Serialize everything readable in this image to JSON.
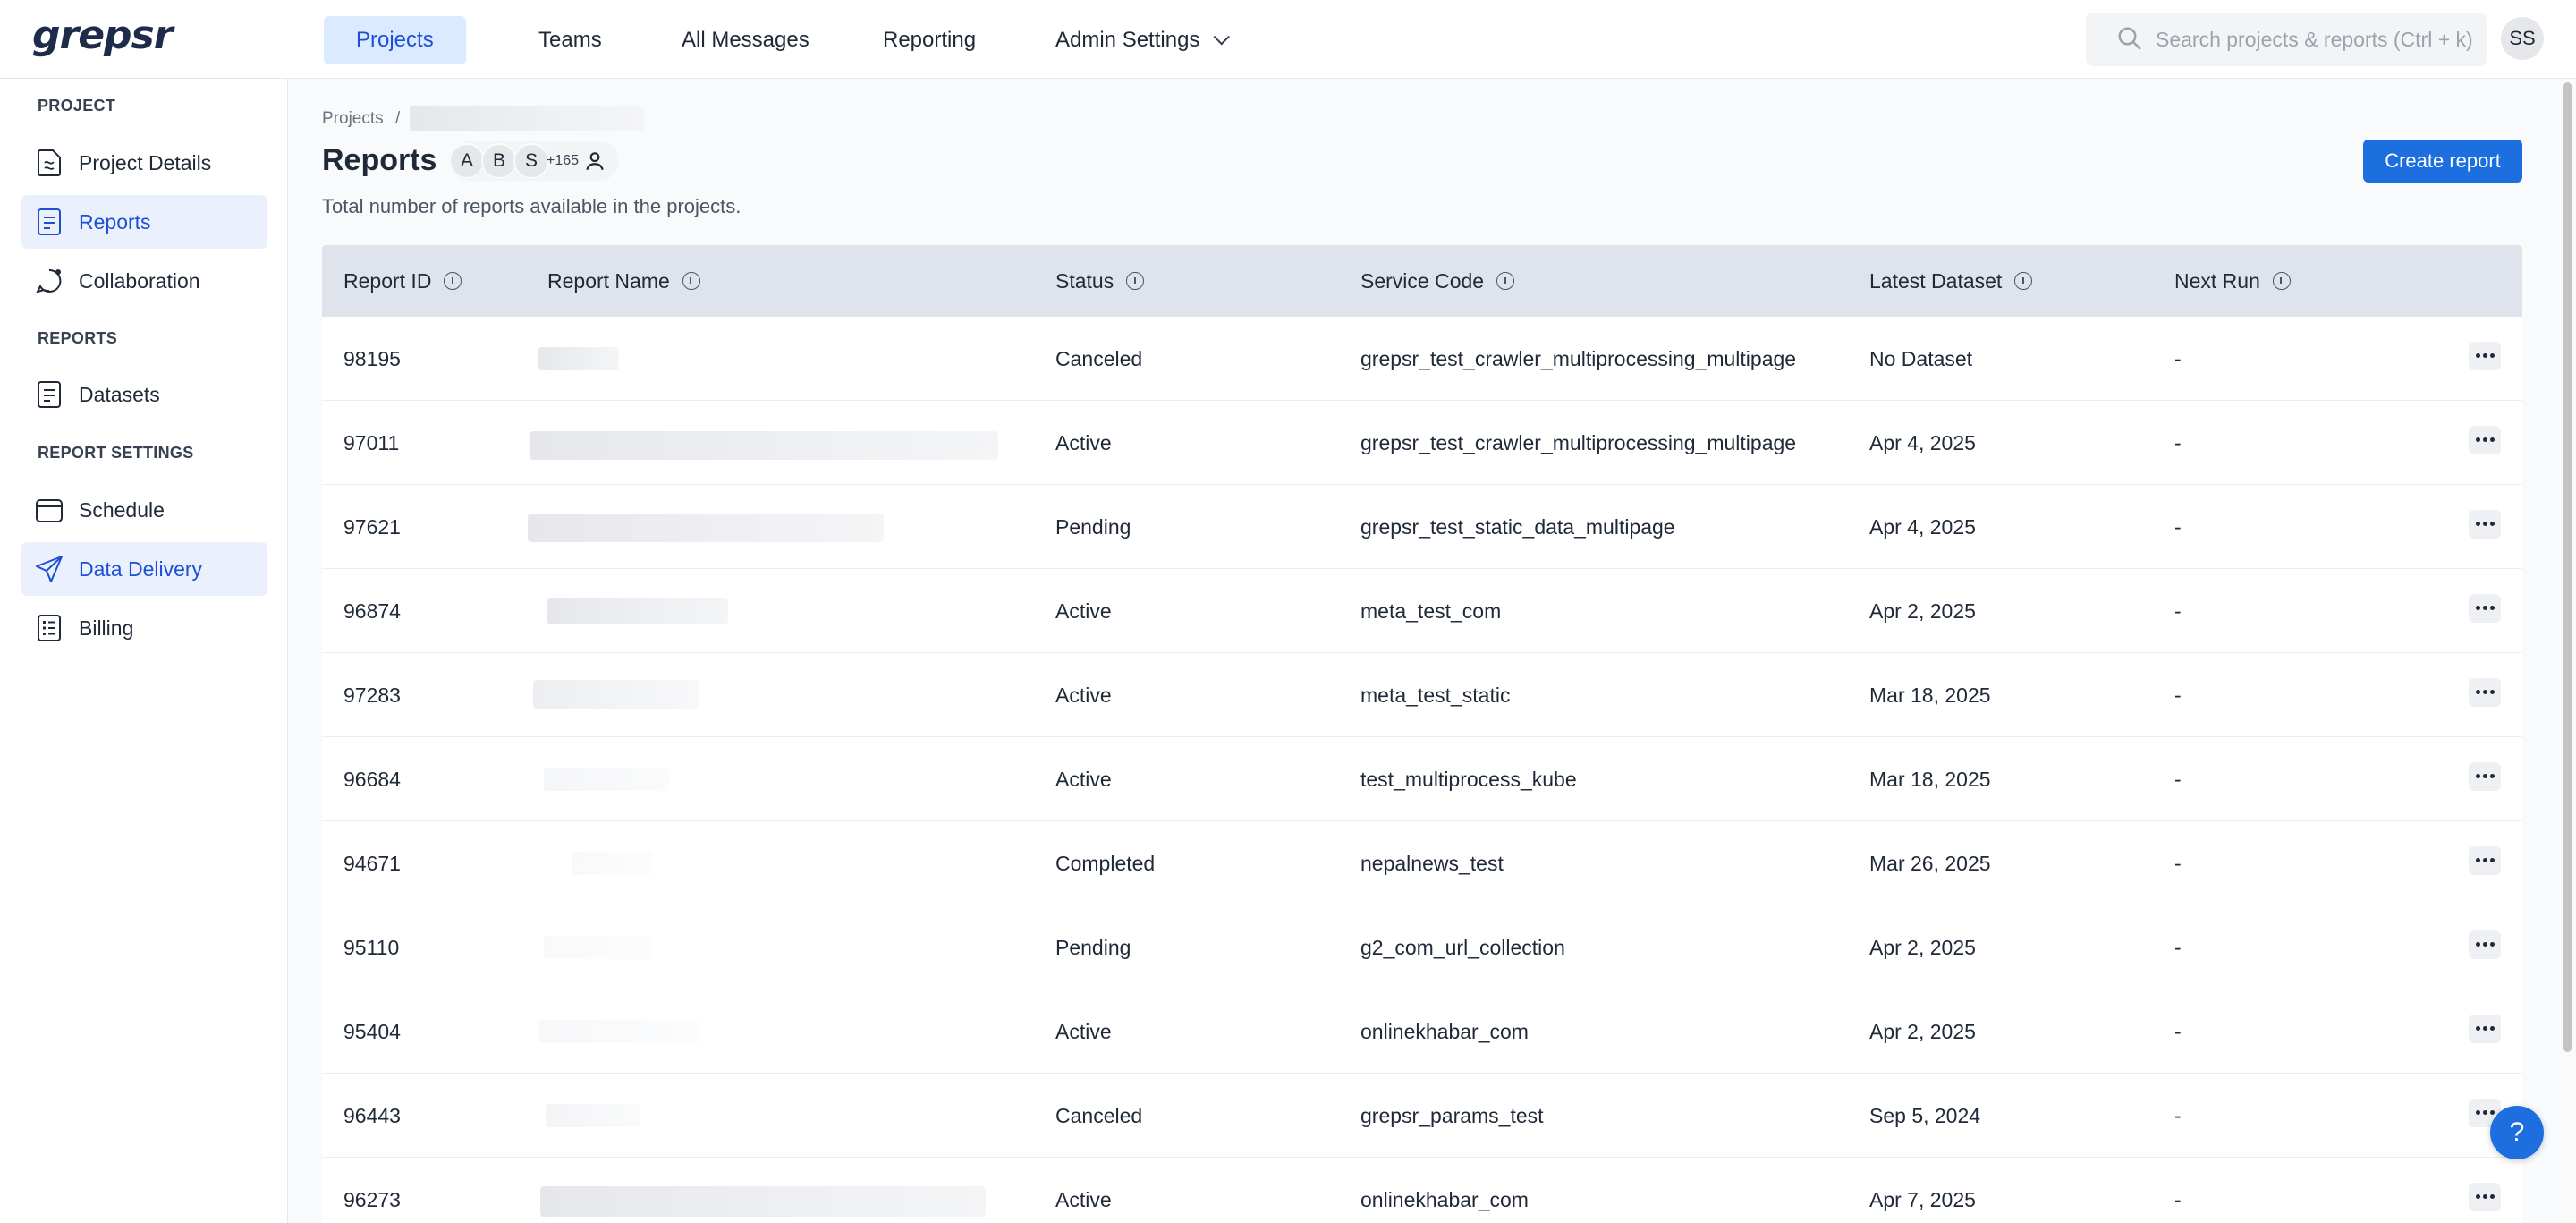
{
  "brand": {
    "logo_text": "grepsr"
  },
  "topnav": {
    "items": [
      {
        "label": "Projects",
        "active": true
      },
      {
        "label": "Teams"
      },
      {
        "label": "All Messages"
      },
      {
        "label": "Reporting"
      },
      {
        "label": "Admin Settings",
        "has_dropdown": true
      }
    ],
    "search_placeholder": "Search projects & reports (Ctrl + k)",
    "user_initials": "SS"
  },
  "sidebar": {
    "sections": [
      {
        "title": "PROJECT",
        "items": [
          {
            "label": "Project Details",
            "icon": "document-icon"
          },
          {
            "label": "Reports",
            "icon": "report-icon",
            "active": true
          },
          {
            "label": "Collaboration",
            "icon": "chat-icon"
          }
        ]
      },
      {
        "title": "REPORTS",
        "items": [
          {
            "label": "Datasets",
            "icon": "dataset-icon"
          }
        ]
      },
      {
        "title": "REPORT SETTINGS",
        "items": [
          {
            "label": "Schedule",
            "icon": "calendar-icon"
          },
          {
            "label": "Data Delivery",
            "icon": "send-icon",
            "active": true
          },
          {
            "label": "Billing",
            "icon": "billing-icon"
          }
        ]
      }
    ]
  },
  "main": {
    "breadcrumb_root": "Projects",
    "breadcrumb_sep": "/",
    "title": "Reports",
    "collaborators": [
      "A",
      "B",
      "S"
    ],
    "collaborators_more": "+165",
    "subtitle": "Total number of reports available in the projects.",
    "create_button": "Create report"
  },
  "table": {
    "columns": [
      "Report ID",
      "Report Name",
      "Status",
      "Service Code",
      "Latest Dataset",
      "Next Run"
    ],
    "rows": [
      {
        "id": "98195",
        "status": "Canceled",
        "service_code": "grepsr_test_crawler_multiprocessing_multipage",
        "latest_dataset": "No Dataset",
        "next_run": "-"
      },
      {
        "id": "97011",
        "status": "Active",
        "service_code": "grepsr_test_crawler_multiprocessing_multipage",
        "latest_dataset": "Apr 4, 2025",
        "next_run": "-"
      },
      {
        "id": "97621",
        "status": "Pending",
        "service_code": "grepsr_test_static_data_multipage",
        "latest_dataset": "Apr 4, 2025",
        "next_run": "-"
      },
      {
        "id": "96874",
        "status": "Active",
        "service_code": "meta_test_com",
        "latest_dataset": "Apr 2, 2025",
        "next_run": "-"
      },
      {
        "id": "97283",
        "status": "Active",
        "service_code": "meta_test_static",
        "latest_dataset": "Mar 18, 2025",
        "next_run": "-"
      },
      {
        "id": "96684",
        "status": "Active",
        "service_code": "test_multiprocess_kube",
        "latest_dataset": "Mar 18, 2025",
        "next_run": "-"
      },
      {
        "id": "94671",
        "status": "Completed",
        "service_code": "nepalnews_test",
        "latest_dataset": "Mar 26, 2025",
        "next_run": "-"
      },
      {
        "id": "95110",
        "status": "Pending",
        "service_code": "g2_com_url_collection",
        "latest_dataset": "Apr 2, 2025",
        "next_run": "-"
      },
      {
        "id": "95404",
        "status": "Active",
        "service_code": "onlinekhabar_com",
        "latest_dataset": "Apr 2, 2025",
        "next_run": "-"
      },
      {
        "id": "96443",
        "status": "Canceled",
        "service_code": "grepsr_params_test",
        "latest_dataset": "Sep 5, 2024",
        "next_run": "-"
      },
      {
        "id": "96273",
        "status": "Active",
        "service_code": "onlinekhabar_com",
        "latest_dataset": "Apr 7, 2025",
        "next_run": "-"
      }
    ]
  },
  "help_label": "?",
  "colors": {
    "accent": "#1d6fe0",
    "active_nav_bg": "#dbeafe",
    "table_header_bg": "#dfe3ec"
  }
}
